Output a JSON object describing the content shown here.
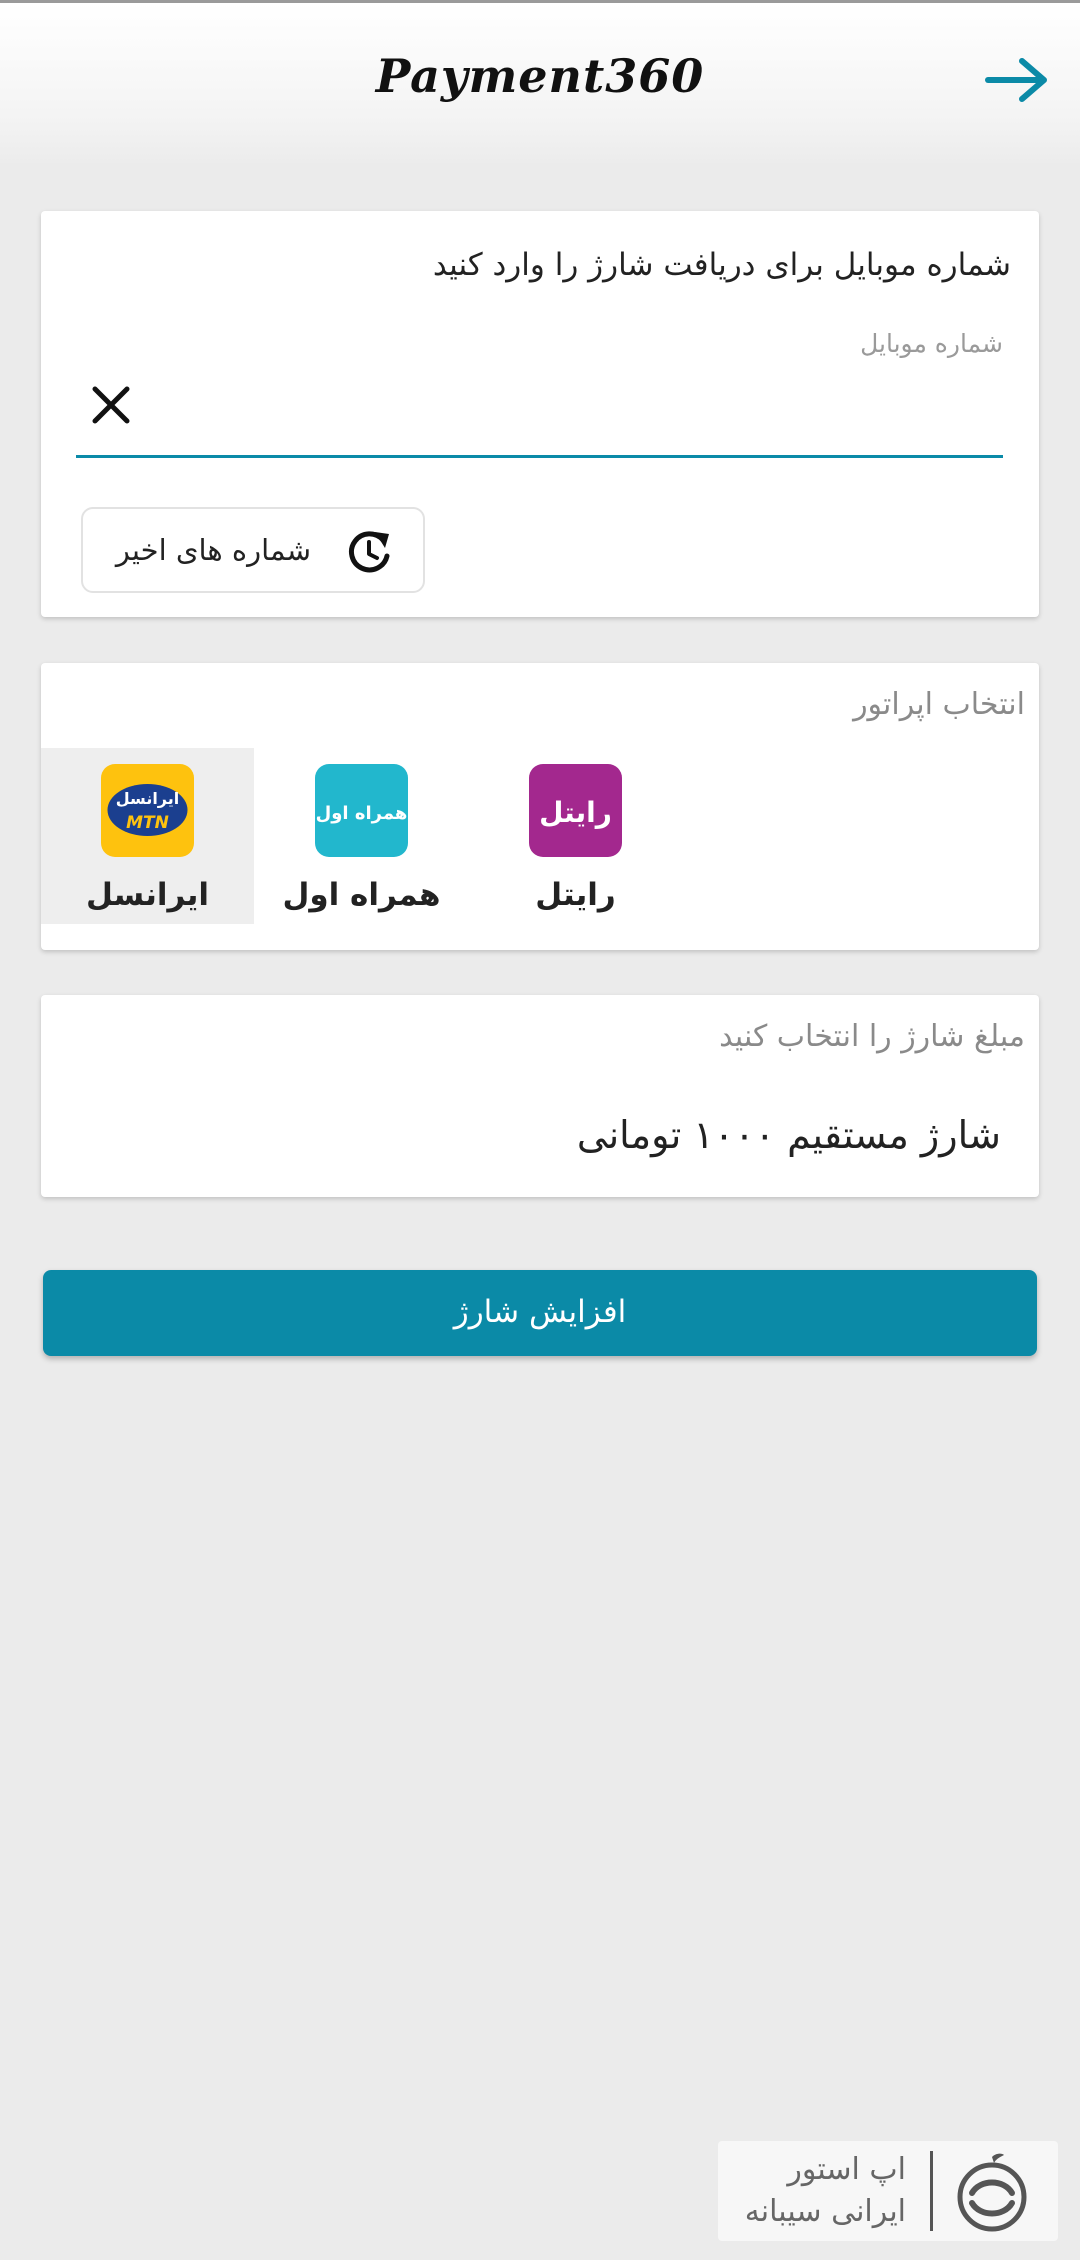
{
  "app": {
    "title": "Payment360",
    "back_icon": "arrow-right-icon",
    "accent_color": "#0b8aa7"
  },
  "phone_card": {
    "title": "شماره موبایل برای دریافت شارژ را وارد کنید",
    "field_label": "شماره موبایل",
    "field_value": "",
    "clear_icon": "close-icon",
    "recent_button_label": "شماره های اخیر",
    "recent_icon": "history-icon"
  },
  "operator_card": {
    "title": "انتخاب اپراتور",
    "operators": [
      {
        "name": "ایرانسل",
        "logo_text": "ایرانسل",
        "logo_sub": "MTN",
        "color": "#fec20e",
        "selected": true
      },
      {
        "name": "همراه اول",
        "logo_text": "همراه اول",
        "color": "#22b7cd",
        "selected": false
      },
      {
        "name": "رایتل",
        "logo_text": "رایتل",
        "color": "#a3288e",
        "selected": false
      }
    ]
  },
  "amount_card": {
    "title": "مبلغ شارژ را انتخاب کنید",
    "selected_amount": "شارژ مستقیم ۱۰۰۰ تومانی"
  },
  "submit_button": {
    "label": "افزایش شارژ"
  },
  "store_badge": {
    "line1": "اپ استور",
    "line2": "ایرانی سیبانه",
    "logo_icon": "apple-store-logo-icon"
  }
}
